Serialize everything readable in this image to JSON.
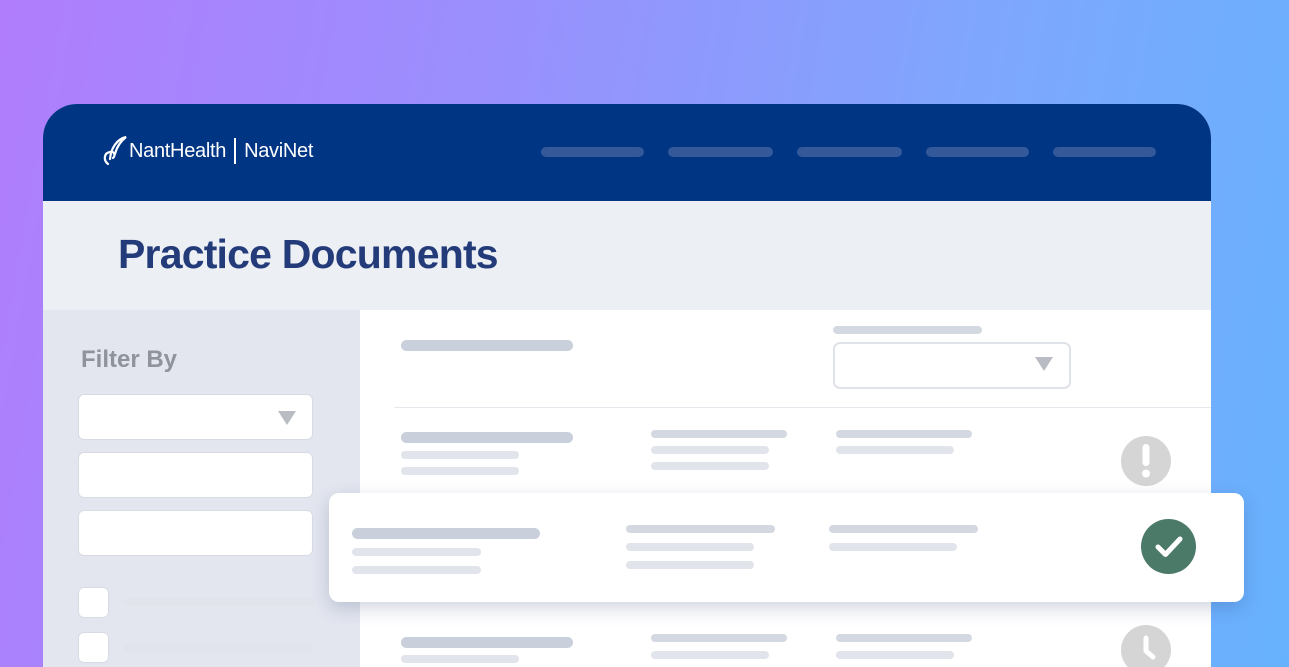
{
  "header": {
    "brand_primary": "NantHealth",
    "brand_secondary": "NaviNet",
    "background_color": "#003584"
  },
  "page": {
    "title": "Practice Documents",
    "title_color": "#233b79"
  },
  "sidebar": {
    "filter_label": "Filter By"
  },
  "documents": {
    "rows": [
      {
        "status": "exclamation-icon"
      },
      {
        "status": "check-icon",
        "status_color": "#4c7a68",
        "highlighted": true
      },
      {
        "status": "clock-icon"
      }
    ]
  }
}
